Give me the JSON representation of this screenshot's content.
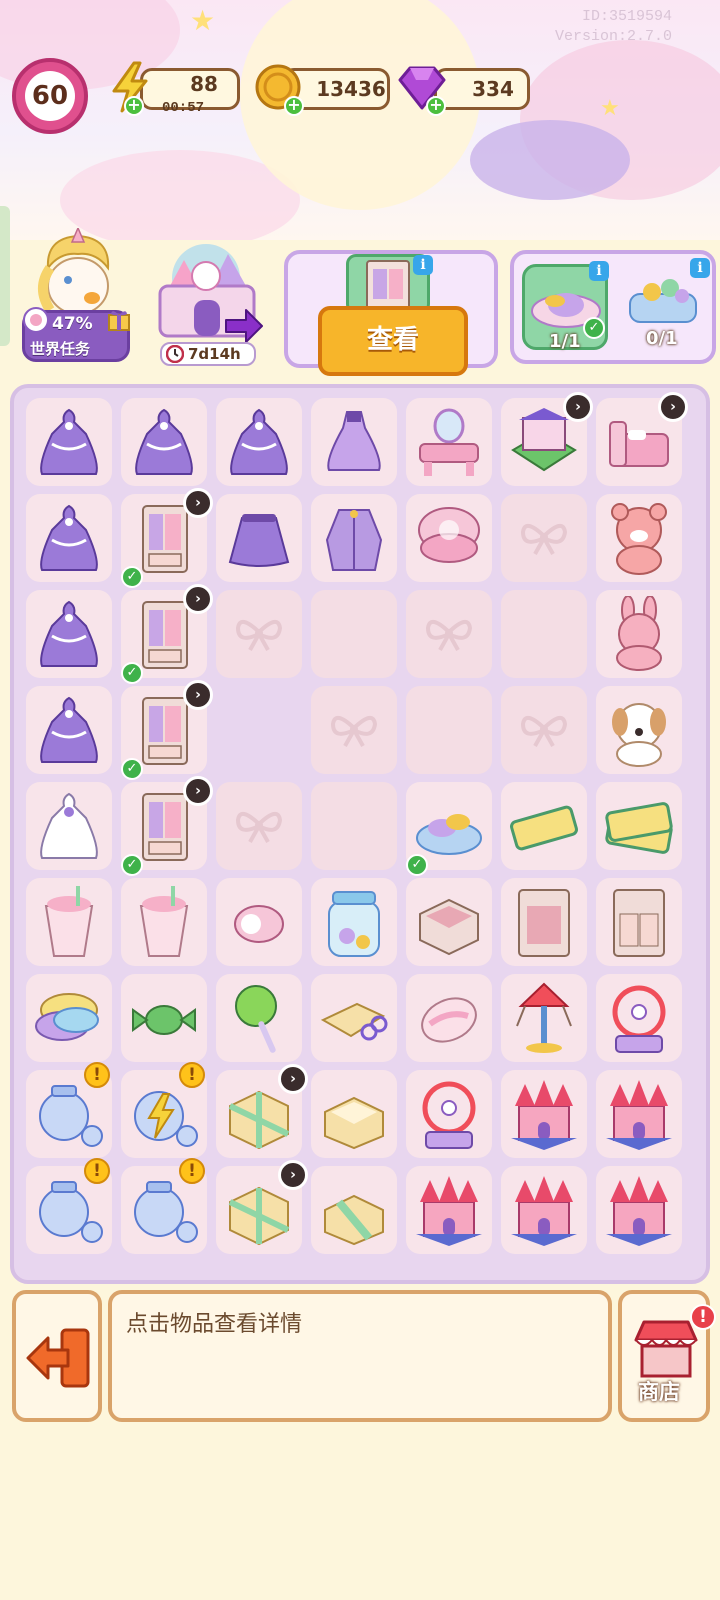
{
  "meta": {
    "id_text": "ID:3519594",
    "version_text": "Version:2.7.0"
  },
  "header": {
    "level": "60",
    "energy": {
      "value": "88",
      "timer": "00:57"
    },
    "coins": {
      "value": "13436"
    },
    "gems": {
      "value": "334"
    }
  },
  "tasks": {
    "world_task": {
      "percent": "47%",
      "label": "世界任务"
    },
    "event": {
      "countdown": "7d14h"
    },
    "view_button_label": "查看",
    "orders": [
      {
        "item": "candy-plate-icon",
        "count": "1/1",
        "done": true
      },
      {
        "item": "candy-basket-icon",
        "count": "0/1",
        "done": false
      }
    ]
  },
  "board": {
    "rows": [
      [
        {
          "item": "purple-gown",
          "state": "normal"
        },
        {
          "item": "purple-gown",
          "state": "normal"
        },
        {
          "item": "purple-gown",
          "state": "normal"
        },
        {
          "item": "lilac-dress",
          "state": "normal"
        },
        {
          "item": "vanity-table",
          "state": "normal"
        },
        {
          "item": "sweet-shop",
          "state": "locked"
        },
        {
          "item": "pink-bed",
          "state": "locked"
        }
      ],
      [
        {
          "item": "purple-gown",
          "state": "normal"
        },
        {
          "item": "wardrobe",
          "state": "locked-done"
        },
        {
          "item": "purple-skirt",
          "state": "normal"
        },
        {
          "item": "purple-jacket",
          "state": "normal"
        },
        {
          "item": "compact-mirror",
          "state": "normal"
        },
        {
          "item": "empty",
          "state": "bow"
        },
        {
          "item": "bear-plush",
          "state": "normal"
        }
      ],
      [
        {
          "item": "purple-gown",
          "state": "normal"
        },
        {
          "item": "wardrobe",
          "state": "locked-done"
        },
        {
          "item": "empty",
          "state": "bow"
        },
        {
          "item": "empty",
          "state": "blank"
        },
        {
          "item": "empty",
          "state": "bow"
        },
        {
          "item": "empty",
          "state": "blank"
        },
        {
          "item": "bunny-plush",
          "state": "normal"
        }
      ],
      [
        {
          "item": "purple-gown",
          "state": "normal"
        },
        {
          "item": "wardrobe",
          "state": "locked-done"
        },
        {
          "item": "empty",
          "state": "none"
        },
        {
          "item": "empty",
          "state": "bow"
        },
        {
          "item": "empty",
          "state": "blank"
        },
        {
          "item": "empty",
          "state": "bow"
        },
        {
          "item": "puppy-plush",
          "state": "normal"
        }
      ],
      [
        {
          "item": "white-gown",
          "state": "normal"
        },
        {
          "item": "wardrobe",
          "state": "locked-done"
        },
        {
          "item": "empty",
          "state": "bow"
        },
        {
          "item": "empty",
          "state": "blank"
        },
        {
          "item": "candy-plate",
          "state": "done"
        },
        {
          "item": "ticket",
          "state": "normal"
        },
        {
          "item": "tickets",
          "state": "normal"
        }
      ],
      [
        {
          "item": "milkshake",
          "state": "normal"
        },
        {
          "item": "milkshake",
          "state": "normal"
        },
        {
          "item": "roll-cake",
          "state": "normal"
        },
        {
          "item": "candy-jar",
          "state": "normal"
        },
        {
          "item": "drawer",
          "state": "normal"
        },
        {
          "item": "cabinet",
          "state": "normal"
        },
        {
          "item": "dresser",
          "state": "normal"
        }
      ],
      [
        {
          "item": "cotton-candy",
          "state": "normal"
        },
        {
          "item": "green-candy",
          "state": "normal"
        },
        {
          "item": "lollipop",
          "state": "normal"
        },
        {
          "item": "paper-scissors",
          "state": "normal"
        },
        {
          "item": "marshmallow",
          "state": "normal"
        },
        {
          "item": "swing-ride",
          "state": "normal"
        },
        {
          "item": "ferris-wheel",
          "state": "normal"
        }
      ],
      [
        {
          "item": "glass-jar",
          "state": "alert"
        },
        {
          "item": "energy-jar",
          "state": "alert"
        },
        {
          "item": "gift-box",
          "state": "locked"
        },
        {
          "item": "open-box",
          "state": "normal"
        },
        {
          "item": "ferris-wheel",
          "state": "normal"
        },
        {
          "item": "castle",
          "state": "normal"
        },
        {
          "item": "castle",
          "state": "normal"
        }
      ],
      [
        {
          "item": "glass-jar",
          "state": "alert"
        },
        {
          "item": "glass-jar",
          "state": "alert"
        },
        {
          "item": "gift-box",
          "state": "locked"
        },
        {
          "item": "ribbon-box",
          "state": "normal"
        },
        {
          "item": "castle",
          "state": "normal"
        },
        {
          "item": "castle",
          "state": "normal"
        },
        {
          "item": "castle",
          "state": "normal"
        }
      ]
    ]
  },
  "footer": {
    "info_text": "点击物品查看详情",
    "shop_label": "商店",
    "shop_alert": "!"
  },
  "colors": {
    "gown": "#9b7ad8",
    "pink": "#f3a6c4",
    "wood": "#f0dcd8",
    "mint": "#8fd6a6",
    "gold": "#f2c64a"
  }
}
